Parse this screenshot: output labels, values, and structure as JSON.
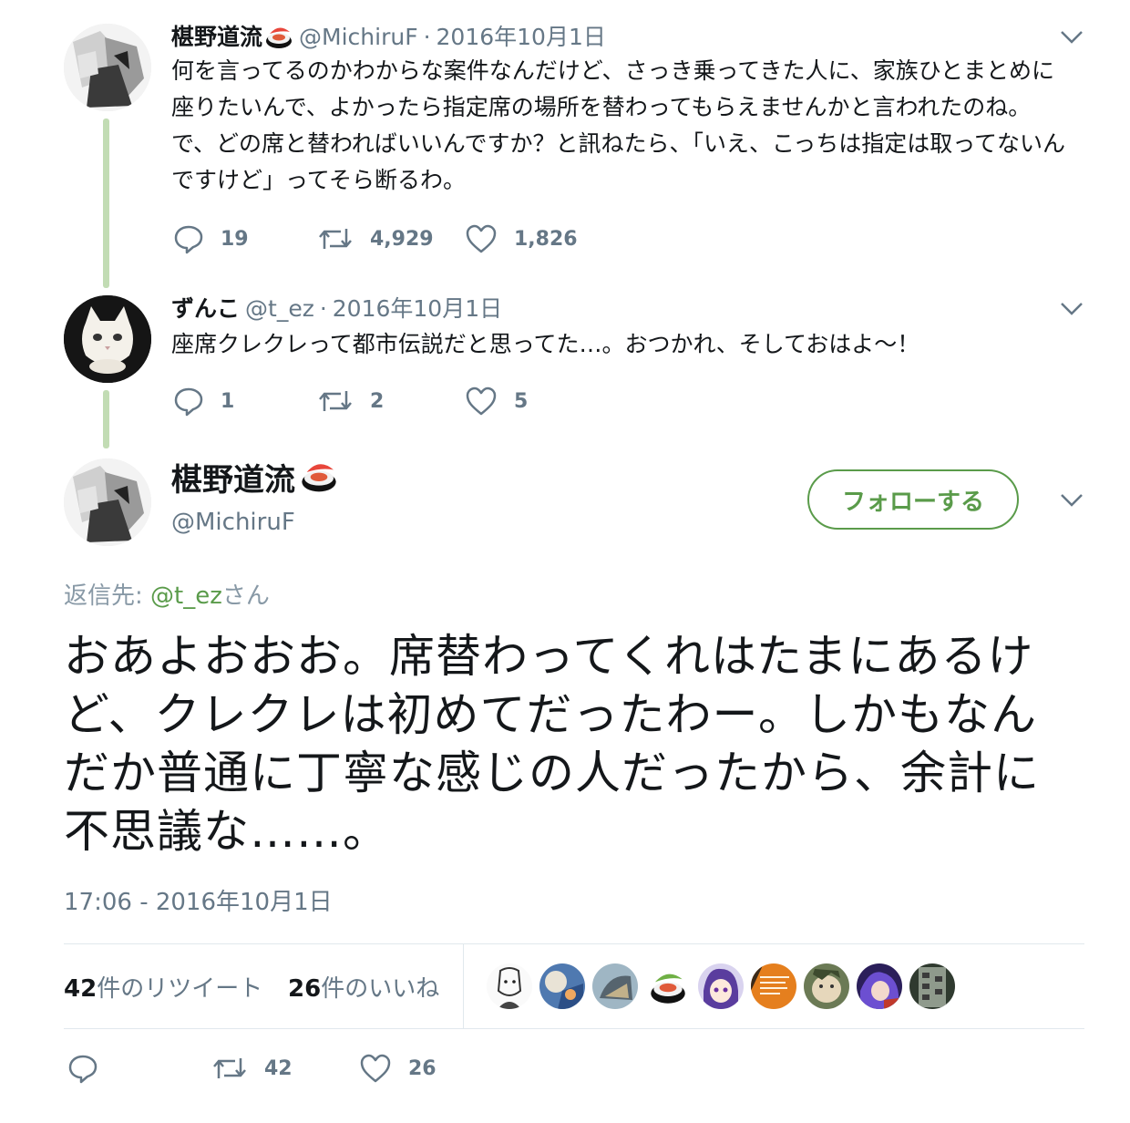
{
  "thread": [
    {
      "name": "椹野道流",
      "handle": "@MichiruF",
      "date": "2016年10月1日",
      "text": "何を言ってるのかわからな案件なんだけど、さっき乗ってきた人に、家族ひとまとめに座りたいんで、よかったら指定席の場所を替わってもらえませんかと言われたのね。で、どの席と替わればいいんですか？と訊ねたら、「いえ、こっちは指定は取ってないんですけど」ってそら断るわ。",
      "replies": "19",
      "retweets": "4,929",
      "likes": "1,826"
    },
    {
      "name": "ずんこ",
      "handle": "@t_ez",
      "date": "2016年10月1日",
      "text": "座席クレクレって都市伝説だと思ってた…。おつかれ、そしておはよ〜！",
      "replies": "1",
      "retweets": "2",
      "likes": "5"
    }
  ],
  "main": {
    "name": "椹野道流",
    "handle": "@MichiruF",
    "follow_label": "フォローする",
    "reply_prefix": "返信先: ",
    "reply_mention": "@t_ez",
    "reply_suffix": "さん",
    "text": "おあよおおお。席替わってくれはたまにあるけど、クレクレは初めてだったわー。しかもなんだか普通に丁寧な感じの人だったから、余計に不思議な……。",
    "timestamp": "17:06 - 2016年10月1日",
    "retweet_count": "42",
    "retweet_label": "件のリツイート",
    "like_count": "26",
    "like_label": "件のいいね",
    "action_retweets": "42",
    "action_likes": "26"
  },
  "colors": {
    "accent": "#5a9b4a",
    "thread_line": "#c2dcb4",
    "muted": "#657786"
  }
}
